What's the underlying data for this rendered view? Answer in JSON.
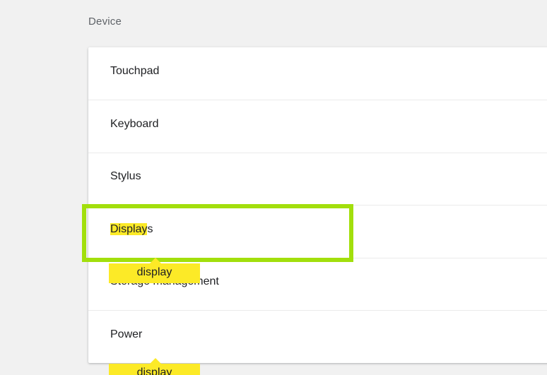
{
  "section": {
    "title": "Device"
  },
  "rows": [
    {
      "label": "Touchpad"
    },
    {
      "label": "Keyboard"
    },
    {
      "label": "Stylus"
    },
    {
      "label_highlight": "Display",
      "label_rest": "s"
    },
    {
      "label": "Storage management"
    },
    {
      "label": "Power"
    }
  ],
  "search_bubbles": [
    {
      "text": "display"
    },
    {
      "text": "display"
    }
  ],
  "colors": {
    "highlight": "#fcea27",
    "focus_ring": "#a2df0c",
    "background": "#f1f1f1"
  }
}
